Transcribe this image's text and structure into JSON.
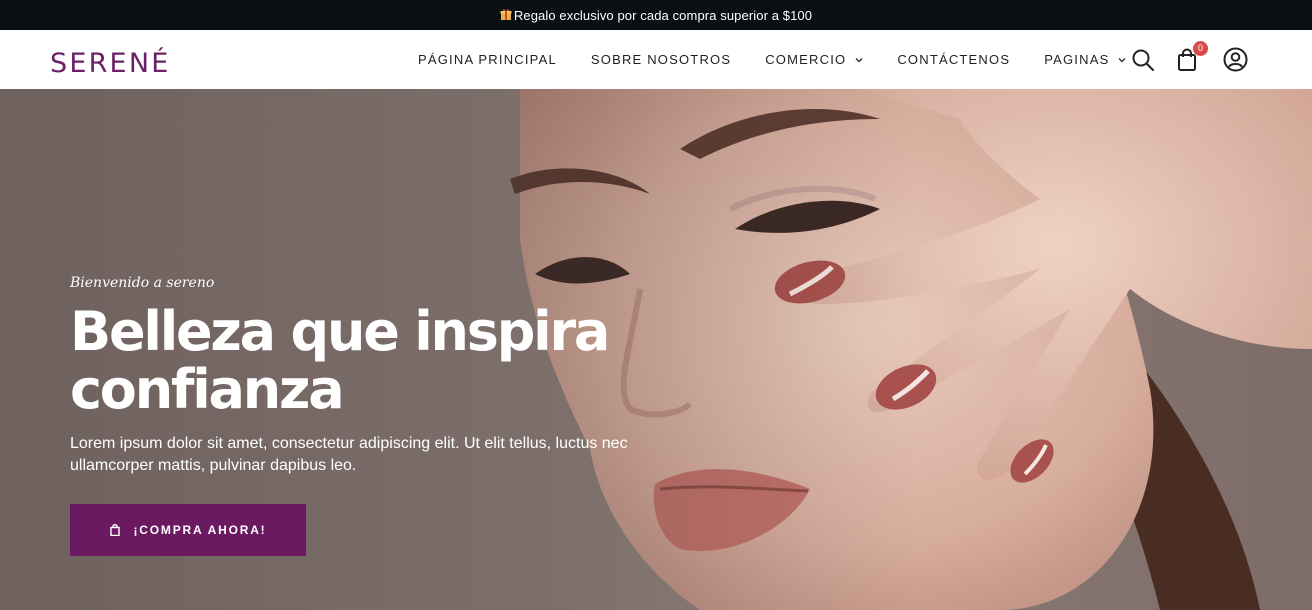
{
  "topbar": {
    "text": "Regalo exclusivo por cada compra superior a $100",
    "icon": "gift-icon"
  },
  "header": {
    "logo": "SERENÉ",
    "nav": [
      {
        "label": "PÁGINA PRINCIPAL",
        "dropdown": false
      },
      {
        "label": "SOBRE NOSOTROS",
        "dropdown": false
      },
      {
        "label": "COMERCIO",
        "dropdown": true
      },
      {
        "label": "CONTÁCTENOS",
        "dropdown": false
      },
      {
        "label": "PAGINAS",
        "dropdown": true
      }
    ],
    "cart_count": "0",
    "icons": [
      "search-icon",
      "cart-icon",
      "user-icon"
    ]
  },
  "hero": {
    "eyebrow": "Bienvenido a sereno",
    "headline_line1": "Belleza que inspira",
    "headline_line2": "confianza",
    "description": "Lorem ipsum dolor sit amet, consectetur adipiscing elit. Ut elit tellus, luctus nec ullamcorper mattis, pulvinar dapibus leo.",
    "cta_label": "¡COMPRA AHORA!"
  },
  "colors": {
    "brand": "#6b1f66",
    "cta": "#6b1a61",
    "topbar": "#0b0f12",
    "badge": "#d94b4b"
  }
}
